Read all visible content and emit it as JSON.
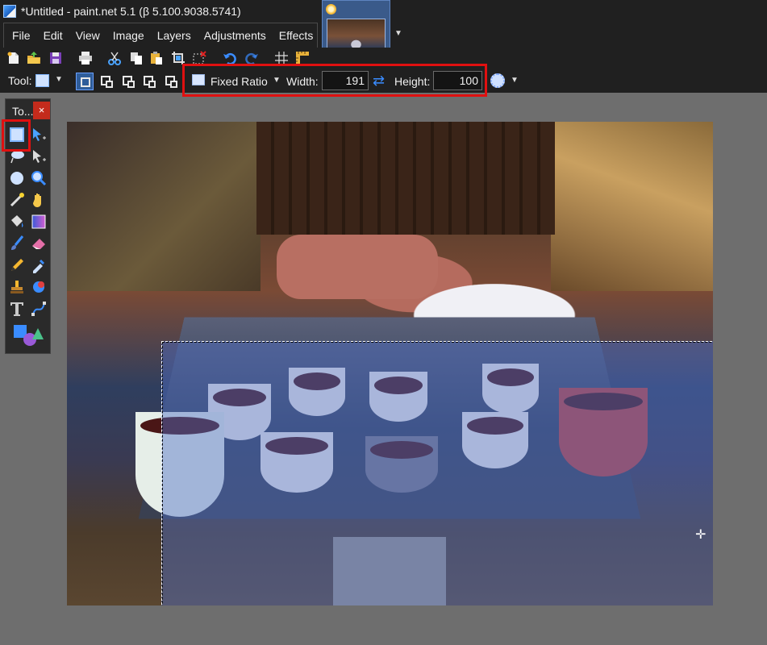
{
  "window": {
    "title": "*Untitled - paint.net 5.1 (β 5.100.9038.5741)"
  },
  "menu": {
    "items": [
      "File",
      "Edit",
      "View",
      "Image",
      "Layers",
      "Adjustments",
      "Effects"
    ]
  },
  "toolbar": {
    "icons": [
      "new-icon",
      "open-icon",
      "save-icon",
      "print-icon",
      "cut-icon",
      "copy-icon",
      "paste-icon",
      "crop-icon",
      "deselect-icon",
      "undo-icon",
      "redo-icon",
      "grid-icon",
      "ruler-icon"
    ]
  },
  "tool_options": {
    "tool_label": "Tool:",
    "ratio_mode": "Fixed Ratio",
    "width_label": "Width:",
    "width_value": "191",
    "height_label": "Height:",
    "height_value": "100"
  },
  "tools_panel": {
    "title": "To...",
    "close": "×"
  },
  "colors": {
    "accent": "#2f5d9a",
    "highlight_red": "#e01010",
    "selection_fill": "#506ec8"
  }
}
